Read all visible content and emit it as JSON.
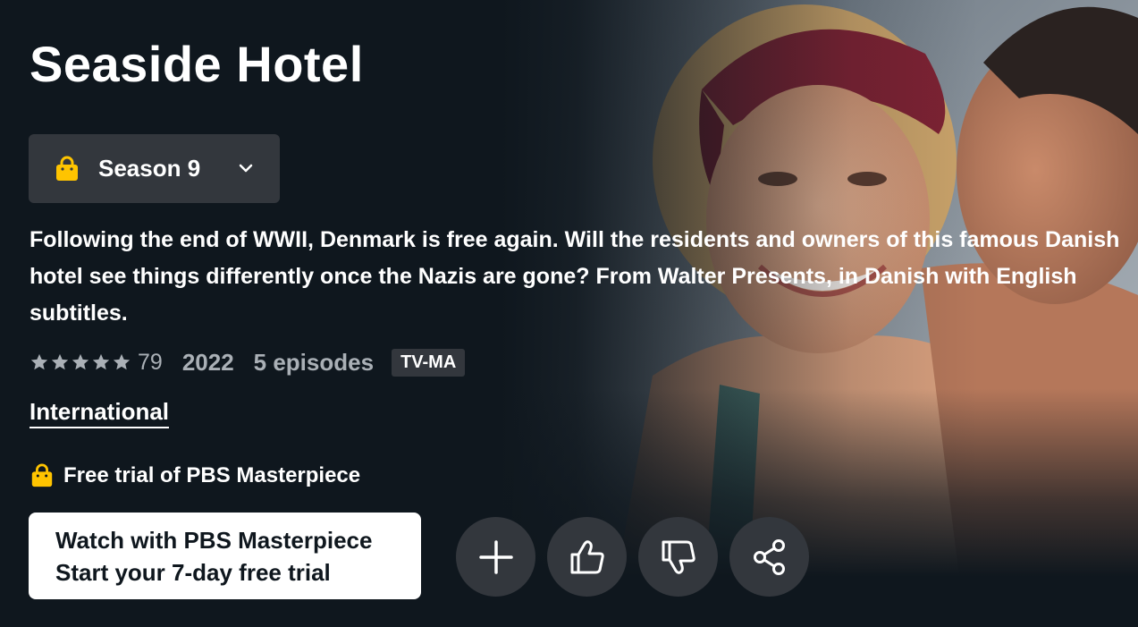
{
  "title": "Seaside Hotel",
  "season_selector": {
    "label": "Season 9",
    "icon": "shopping-bag-icon",
    "dropdown_icon": "chevron-down-icon"
  },
  "synopsis": "Following the end of WWII, Denmark is free again. Will the residents and owners of this famous Danish hotel see things differently once the Nazis are gone? From Walter Presents, in Danish with English subtitles.",
  "meta": {
    "star_rating": 5,
    "rating_count": "79",
    "year": "2022",
    "episodes": "5 episodes",
    "maturity_rating": "TV-MA"
  },
  "genre": "International",
  "trial_offer": {
    "icon": "shopping-bag-icon",
    "text": "Free trial of PBS Masterpiece"
  },
  "watch_button": {
    "line1": "Watch with PBS Masterpiece",
    "line2": "Start your 7-day free trial"
  },
  "actions": [
    {
      "name": "add-to-watchlist",
      "icon": "plus-icon"
    },
    {
      "name": "like",
      "icon": "thumbs-up-icon"
    },
    {
      "name": "dislike",
      "icon": "thumbs-down-icon"
    },
    {
      "name": "share",
      "icon": "share-icon"
    }
  ],
  "colors": {
    "background": "#0f171e",
    "button_dark": "#33373d",
    "bag_yellow": "#ffc400",
    "muted_text": "#aab0b6"
  }
}
